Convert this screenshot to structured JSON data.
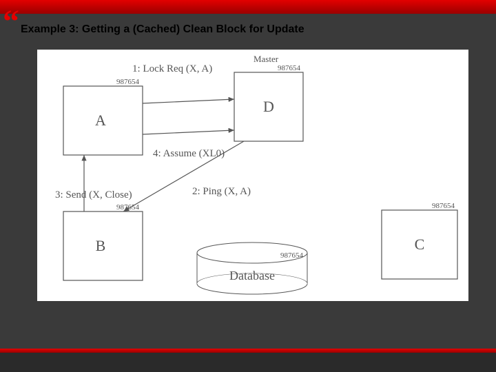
{
  "slide": {
    "title": "Example 3: Getting a (Cached) Clean Block for Update",
    "quote": "“"
  },
  "nodes": {
    "A": {
      "name": "A",
      "id": "987654"
    },
    "B": {
      "name": "B",
      "id": "987654"
    },
    "C": {
      "name": "C",
      "id": "987654"
    },
    "D": {
      "name": "D",
      "id": "987654"
    },
    "D_role": "Master"
  },
  "edges": {
    "e1": "1: Lock Req (X, A)",
    "e2": "2: Ping (X, A)",
    "e3": "3: Send (X, Close)",
    "e4": "4: Assume (XL0)"
  },
  "database": {
    "label": "Database",
    "id": "987654"
  }
}
